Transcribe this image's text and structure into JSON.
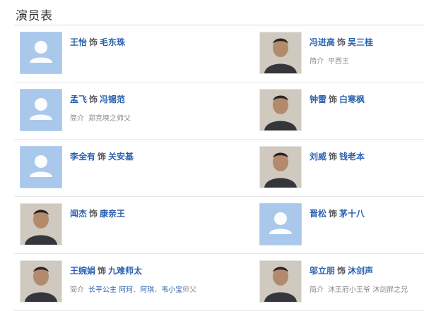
{
  "page": {
    "title": "演员表"
  },
  "cast_rows": [
    {
      "left": {
        "actor": "王怡",
        "sep": "饰",
        "role": "毛东珠",
        "intro_label": "",
        "intro_parts": [],
        "avatar": "placeholder"
      },
      "right": {
        "actor": "冯进高",
        "sep": "饰",
        "role": "吴三桂",
        "intro_label": "简介",
        "intro_parts": [
          {
            "text": "平西王",
            "link": false
          }
        ],
        "avatar": "photo"
      }
    },
    {
      "left": {
        "actor": "孟飞",
        "sep": "饰",
        "role": "冯锡范",
        "intro_label": "简介",
        "intro_parts": [
          {
            "text": "郑克塽之师父",
            "link": false
          }
        ],
        "avatar": "placeholder"
      },
      "right": {
        "actor": "钟雷",
        "sep": "饰",
        "role": "白寒枫",
        "intro_label": "",
        "intro_parts": [],
        "avatar": "photo"
      }
    },
    {
      "left": {
        "actor": "李全有",
        "sep": "饰",
        "role": "关安基",
        "intro_label": "",
        "intro_parts": [],
        "avatar": "placeholder"
      },
      "right": {
        "actor": "刘威",
        "sep": "饰",
        "role": "钱老本",
        "intro_label": "",
        "intro_parts": [],
        "avatar": "photo"
      }
    },
    {
      "left": {
        "actor": "闻杰",
        "sep": "饰",
        "role": "康亲王",
        "intro_label": "",
        "intro_parts": [],
        "avatar": "photo"
      },
      "right": {
        "actor": "晋松",
        "sep": "饰",
        "role": "茅十八",
        "intro_label": "",
        "intro_parts": [],
        "avatar": "placeholder"
      }
    },
    {
      "left": {
        "actor": "王婉娟",
        "sep": "饰",
        "role": "九难师太",
        "intro_label": "简介",
        "intro_parts": [
          {
            "text": "长平公主",
            "link": true
          },
          {
            "text": " ",
            "link": false
          },
          {
            "text": "阿珂",
            "link": true
          },
          {
            "text": "、",
            "link": false
          },
          {
            "text": "阿琪",
            "link": true
          },
          {
            "text": "、",
            "link": false
          },
          {
            "text": "韦小宝",
            "link": true
          },
          {
            "text": "师父",
            "link": false
          }
        ],
        "avatar": "photo"
      },
      "right": {
        "actor": "邬立朋",
        "sep": "饰",
        "role": "沐剑声",
        "intro_label": "简介",
        "intro_parts": [
          {
            "text": "沐王府小王爷 沐剑屏之兄",
            "link": false
          }
        ],
        "avatar": "photo"
      }
    }
  ],
  "colors": {
    "link": "#2b63b0",
    "placeholder_bg": "#aac8ec",
    "divider": "#e8e8e8"
  },
  "icons": {
    "placeholder": "person-silhouette-icon"
  }
}
